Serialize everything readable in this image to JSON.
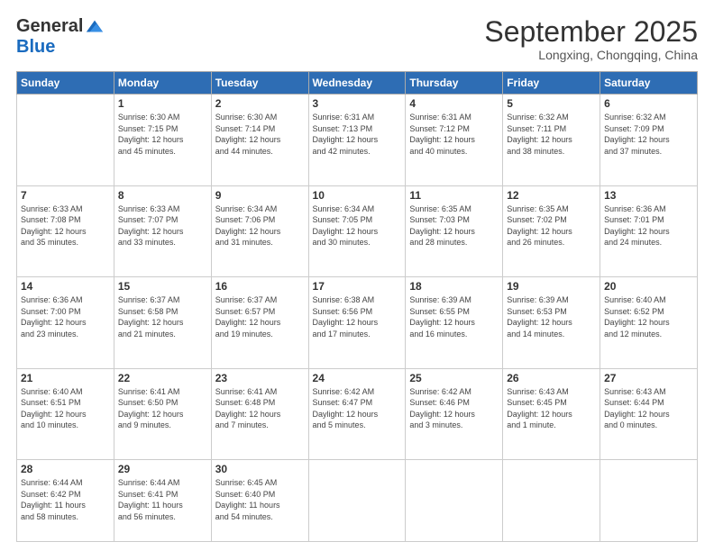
{
  "logo": {
    "general": "General",
    "blue": "Blue"
  },
  "title": "September 2025",
  "location": "Longxing, Chongqing, China",
  "headers": [
    "Sunday",
    "Monday",
    "Tuesday",
    "Wednesday",
    "Thursday",
    "Friday",
    "Saturday"
  ],
  "weeks": [
    [
      {
        "day": "",
        "info": ""
      },
      {
        "day": "1",
        "info": "Sunrise: 6:30 AM\nSunset: 7:15 PM\nDaylight: 12 hours\nand 45 minutes."
      },
      {
        "day": "2",
        "info": "Sunrise: 6:30 AM\nSunset: 7:14 PM\nDaylight: 12 hours\nand 44 minutes."
      },
      {
        "day": "3",
        "info": "Sunrise: 6:31 AM\nSunset: 7:13 PM\nDaylight: 12 hours\nand 42 minutes."
      },
      {
        "day": "4",
        "info": "Sunrise: 6:31 AM\nSunset: 7:12 PM\nDaylight: 12 hours\nand 40 minutes."
      },
      {
        "day": "5",
        "info": "Sunrise: 6:32 AM\nSunset: 7:11 PM\nDaylight: 12 hours\nand 38 minutes."
      },
      {
        "day": "6",
        "info": "Sunrise: 6:32 AM\nSunset: 7:09 PM\nDaylight: 12 hours\nand 37 minutes."
      }
    ],
    [
      {
        "day": "7",
        "info": "Sunrise: 6:33 AM\nSunset: 7:08 PM\nDaylight: 12 hours\nand 35 minutes."
      },
      {
        "day": "8",
        "info": "Sunrise: 6:33 AM\nSunset: 7:07 PM\nDaylight: 12 hours\nand 33 minutes."
      },
      {
        "day": "9",
        "info": "Sunrise: 6:34 AM\nSunset: 7:06 PM\nDaylight: 12 hours\nand 31 minutes."
      },
      {
        "day": "10",
        "info": "Sunrise: 6:34 AM\nSunset: 7:05 PM\nDaylight: 12 hours\nand 30 minutes."
      },
      {
        "day": "11",
        "info": "Sunrise: 6:35 AM\nSunset: 7:03 PM\nDaylight: 12 hours\nand 28 minutes."
      },
      {
        "day": "12",
        "info": "Sunrise: 6:35 AM\nSunset: 7:02 PM\nDaylight: 12 hours\nand 26 minutes."
      },
      {
        "day": "13",
        "info": "Sunrise: 6:36 AM\nSunset: 7:01 PM\nDaylight: 12 hours\nand 24 minutes."
      }
    ],
    [
      {
        "day": "14",
        "info": "Sunrise: 6:36 AM\nSunset: 7:00 PM\nDaylight: 12 hours\nand 23 minutes."
      },
      {
        "day": "15",
        "info": "Sunrise: 6:37 AM\nSunset: 6:58 PM\nDaylight: 12 hours\nand 21 minutes."
      },
      {
        "day": "16",
        "info": "Sunrise: 6:37 AM\nSunset: 6:57 PM\nDaylight: 12 hours\nand 19 minutes."
      },
      {
        "day": "17",
        "info": "Sunrise: 6:38 AM\nSunset: 6:56 PM\nDaylight: 12 hours\nand 17 minutes."
      },
      {
        "day": "18",
        "info": "Sunrise: 6:39 AM\nSunset: 6:55 PM\nDaylight: 12 hours\nand 16 minutes."
      },
      {
        "day": "19",
        "info": "Sunrise: 6:39 AM\nSunset: 6:53 PM\nDaylight: 12 hours\nand 14 minutes."
      },
      {
        "day": "20",
        "info": "Sunrise: 6:40 AM\nSunset: 6:52 PM\nDaylight: 12 hours\nand 12 minutes."
      }
    ],
    [
      {
        "day": "21",
        "info": "Sunrise: 6:40 AM\nSunset: 6:51 PM\nDaylight: 12 hours\nand 10 minutes."
      },
      {
        "day": "22",
        "info": "Sunrise: 6:41 AM\nSunset: 6:50 PM\nDaylight: 12 hours\nand 9 minutes."
      },
      {
        "day": "23",
        "info": "Sunrise: 6:41 AM\nSunset: 6:48 PM\nDaylight: 12 hours\nand 7 minutes."
      },
      {
        "day": "24",
        "info": "Sunrise: 6:42 AM\nSunset: 6:47 PM\nDaylight: 12 hours\nand 5 minutes."
      },
      {
        "day": "25",
        "info": "Sunrise: 6:42 AM\nSunset: 6:46 PM\nDaylight: 12 hours\nand 3 minutes."
      },
      {
        "day": "26",
        "info": "Sunrise: 6:43 AM\nSunset: 6:45 PM\nDaylight: 12 hours\nand 1 minute."
      },
      {
        "day": "27",
        "info": "Sunrise: 6:43 AM\nSunset: 6:44 PM\nDaylight: 12 hours\nand 0 minutes."
      }
    ],
    [
      {
        "day": "28",
        "info": "Sunrise: 6:44 AM\nSunset: 6:42 PM\nDaylight: 11 hours\nand 58 minutes."
      },
      {
        "day": "29",
        "info": "Sunrise: 6:44 AM\nSunset: 6:41 PM\nDaylight: 11 hours\nand 56 minutes."
      },
      {
        "day": "30",
        "info": "Sunrise: 6:45 AM\nSunset: 6:40 PM\nDaylight: 11 hours\nand 54 minutes."
      },
      {
        "day": "",
        "info": ""
      },
      {
        "day": "",
        "info": ""
      },
      {
        "day": "",
        "info": ""
      },
      {
        "day": "",
        "info": ""
      }
    ]
  ]
}
